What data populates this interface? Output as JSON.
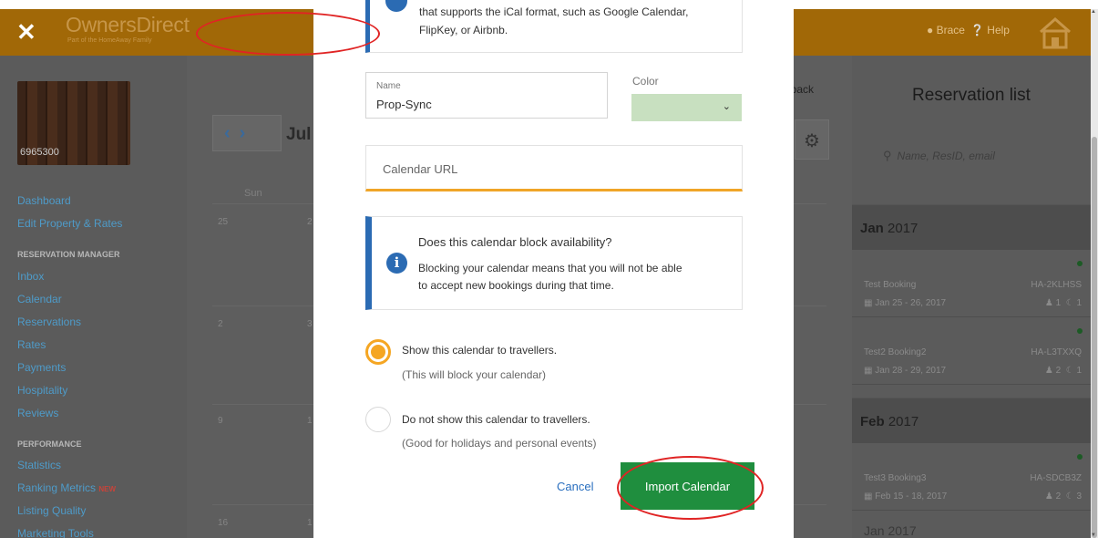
{
  "header": {
    "brand": "OwnersDirect",
    "brand_sub": "Part of the HomeAway Family",
    "user": "Brace",
    "help": "Help"
  },
  "sidebar": {
    "property_id": "6965300",
    "items": [
      {
        "label": "Dashboard"
      },
      {
        "label": "Edit Property & Rates"
      }
    ],
    "section_reservation": "RESERVATION MANAGER",
    "reservation_items": [
      {
        "label": "Inbox"
      },
      {
        "label": "Calendar"
      },
      {
        "label": "Reservations"
      },
      {
        "label": "Rates"
      },
      {
        "label": "Payments"
      },
      {
        "label": "Hospitality"
      },
      {
        "label": "Reviews"
      }
    ],
    "section_performance": "PERFORMANCE",
    "performance_items": [
      {
        "label": "Statistics"
      },
      {
        "label": "Ranking Metrics",
        "badge": "NEW"
      },
      {
        "label": "Listing Quality"
      },
      {
        "label": "Marketing Tools"
      }
    ]
  },
  "calendar": {
    "month_partial": "Jul",
    "day_header": "Sun",
    "feedback": "dback",
    "rows": [
      {
        "d1": "25",
        "d2": "2"
      },
      {
        "d1": "2",
        "d2": "3"
      },
      {
        "d1": "9",
        "d2": "1"
      },
      {
        "d1": "16",
        "d2": "1"
      }
    ]
  },
  "reservation_panel": {
    "title": "Reservation list",
    "search_placeholder": "Name, ResID, email",
    "months": [
      {
        "month": "Jan",
        "year": "2017"
      },
      {
        "month": "Feb",
        "year": "2017"
      }
    ],
    "bookings": [
      {
        "name": "Test Booking",
        "code": "HA-2KLHSS",
        "dates": "Jan 25 - 26, 2017",
        "guests": "1",
        "nights": "1"
      },
      {
        "name": "Test2 Booking2",
        "code": "HA-L3TXXQ",
        "dates": "Jan 28 - 29, 2017",
        "guests": "2",
        "nights": "1"
      },
      {
        "name": "Test3 Booking3",
        "code": "HA-SDCB3Z",
        "dates": "Feb 15 - 18, 2017",
        "guests": "2",
        "nights": "3"
      }
    ],
    "partial_month": "Jan 2017"
  },
  "modal": {
    "info_line1": "that supports the iCal format, such as Google Calendar,",
    "info_line2": "FlipKey, or Airbnb.",
    "name_label": "Name",
    "name_value": "Prop-Sync",
    "color_label": "Color",
    "color_value": "#c8e0c0",
    "url_placeholder": "Calendar URL",
    "block_question": "Does this calendar block availability?",
    "block_desc1": "Blocking your calendar means that you will not be able",
    "block_desc2": "to accept new bookings during that time.",
    "options": [
      {
        "label": "Show this calendar to travellers.",
        "sub": "(This will block your calendar)",
        "selected": true
      },
      {
        "label": "Do not show this calendar to travellers.",
        "sub": "(Good for holidays and personal events)",
        "selected": false
      }
    ],
    "cancel_label": "Cancel",
    "import_label": "Import Calendar"
  },
  "colors": {
    "header_bg": "#a16807",
    "link_blue": "#4e9bc9",
    "accent_orange": "#f5a623",
    "import_green": "#1f8e3e",
    "info_blue": "#2b6bb3",
    "annotation_red": "#e02424"
  }
}
